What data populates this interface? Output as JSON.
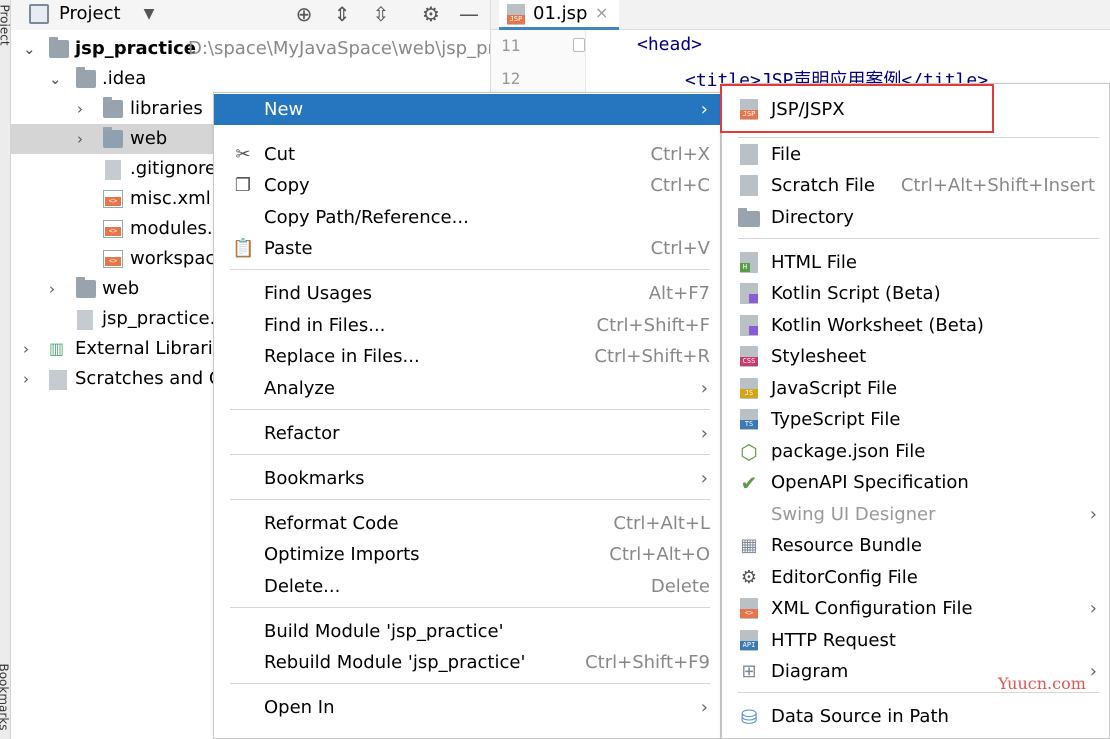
{
  "side_strips": {
    "project": "Project",
    "bookmarks": "Bookmarks"
  },
  "project_toolbar": {
    "title": "Project",
    "icons": [
      "project-window-icon",
      "dropdown-chevron-icon",
      "crosshair-icon",
      "expand-all-icon",
      "collapse-all-icon",
      "gear-icon",
      "minimize-icon"
    ]
  },
  "tree": {
    "root_name": "jsp_practice",
    "root_path": "D:\\space\\MyJavaSpace\\web\\jsp_pra",
    "idea": ".idea",
    "libraries": "libraries",
    "web_inner": "web",
    "gitignore": ".gitignore",
    "misc": "misc.xml",
    "modules": "modules.x",
    "workspace": "workspace",
    "web": "web",
    "iml": "jsp_practice.i",
    "external": "External Librarie",
    "scratches": "Scratches and C"
  },
  "editor": {
    "tab_label": "01.jsp",
    "lines": [
      {
        "num": "11",
        "code": "<head>"
      },
      {
        "num": "12",
        "code": "<title>JSP声明应用案例</title>"
      }
    ]
  },
  "context_menu": {
    "new": "New",
    "cut": "Cut",
    "cut_sc": "Ctrl+X",
    "copy": "Copy",
    "copy_sc": "Ctrl+C",
    "copy_path": "Copy Path/Reference...",
    "paste": "Paste",
    "paste_sc": "Ctrl+V",
    "find_usages": "Find Usages",
    "find_usages_sc": "Alt+F7",
    "find_in_files": "Find in Files...",
    "find_in_files_sc": "Ctrl+Shift+F",
    "replace_in_files": "Replace in Files...",
    "replace_in_files_sc": "Ctrl+Shift+R",
    "analyze": "Analyze",
    "refactor": "Refactor",
    "bookmarks": "Bookmarks",
    "reformat": "Reformat Code",
    "reformat_sc": "Ctrl+Alt+L",
    "optimize": "Optimize Imports",
    "optimize_sc": "Ctrl+Alt+O",
    "delete": "Delete...",
    "delete_sc": "Delete",
    "build_module": "Build Module 'jsp_practice'",
    "rebuild_module": "Rebuild Module 'jsp_practice'",
    "rebuild_module_sc": "Ctrl+Shift+F9",
    "open_in": "Open In"
  },
  "submenu": {
    "jsp": "JSP/JSPX",
    "file": "File",
    "scratch": "Scratch File",
    "scratch_sc": "Ctrl+Alt+Shift+Insert",
    "directory": "Directory",
    "html": "HTML File",
    "kotlin_script": "Kotlin Script (Beta)",
    "kotlin_worksheet": "Kotlin Worksheet (Beta)",
    "stylesheet": "Stylesheet",
    "javascript": "JavaScript File",
    "typescript": "TypeScript File",
    "package_json": "package.json File",
    "openapi": "OpenAPI Specification",
    "swing": "Swing UI Designer",
    "resource_bundle": "Resource Bundle",
    "editorconfig": "EditorConfig File",
    "xml_config": "XML Configuration File",
    "http_request": "HTTP Request",
    "diagram": "Diagram",
    "data_source": "Data Source in Path"
  },
  "icon_badges": {
    "jsp": "JSP",
    "css": "CSS",
    "js": "JS",
    "ts": "TS",
    "api": "API",
    "html": "H",
    "xml": "<>"
  },
  "watermark": "Yuucn.com",
  "colors": {
    "menu_highlight": "#2675bf",
    "annotation_box": "#e03a3a",
    "selected_row": "#d5d5d5",
    "watermark": "#e0554f"
  }
}
